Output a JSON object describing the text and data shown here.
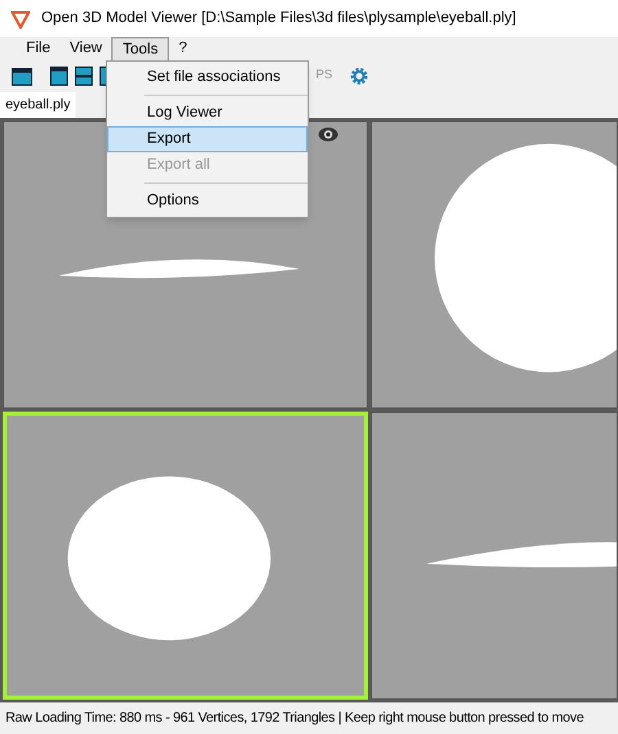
{
  "window": {
    "title": "Open 3D Model Viewer  [D:\\Sample Files\\3d files\\plysample\\eyeball.ply]"
  },
  "menu_bar": [
    {
      "label": "File",
      "selected": false
    },
    {
      "label": "View",
      "selected": false
    },
    {
      "label": "Tools",
      "selected": true
    },
    {
      "label": "?",
      "selected": false
    }
  ],
  "tools_menu": [
    {
      "label": "Set file associations",
      "selected": false,
      "disabled": false
    },
    {
      "label": "Log Viewer",
      "selected": false,
      "disabled": false
    },
    {
      "label": "Export",
      "selected": true,
      "disabled": false
    },
    {
      "label": "Export all",
      "selected": false,
      "disabled": true
    },
    {
      "label": "Options",
      "selected": false,
      "disabled": false
    }
  ],
  "toolbar": {
    "fps_label": "PS"
  },
  "tabs": [
    {
      "label": "eyeball.ply",
      "selected": true
    }
  ],
  "viewports": [
    {
      "kind": "flat",
      "selected": false,
      "eye": true
    },
    {
      "kind": "circle",
      "selected": false,
      "eye": false
    },
    {
      "kind": "ellipse",
      "selected": true,
      "eye": false
    },
    {
      "kind": "flat-right",
      "selected": false,
      "eye": false
    }
  ],
  "status_bar": {
    "text": "Raw Loading Time: 880 ms - 961 Vertices, 1792 Triangles  | Keep right mouse button pressed to move"
  }
}
